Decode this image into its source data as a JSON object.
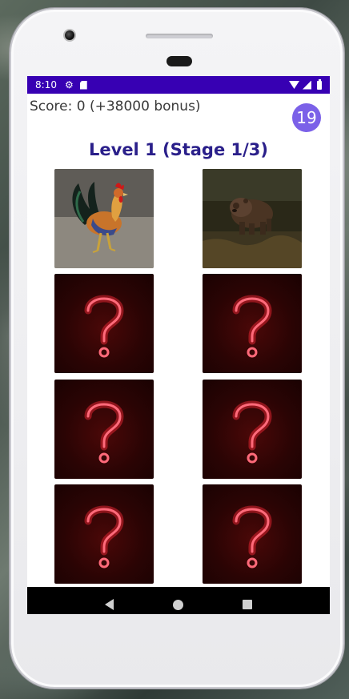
{
  "status_bar": {
    "time": "8:10",
    "background": "#3700b3"
  },
  "game": {
    "score_label": "Score: 0 (+38000 bonus)",
    "timer": "19",
    "level_title": "Level 1 (Stage 1/3)",
    "cards": [
      {
        "state": "revealed",
        "image": "rooster"
      },
      {
        "state": "revealed",
        "image": "bear"
      },
      {
        "state": "hidden",
        "image": "question-mark-icon"
      },
      {
        "state": "hidden",
        "image": "question-mark-icon"
      },
      {
        "state": "hidden",
        "image": "question-mark-icon"
      },
      {
        "state": "hidden",
        "image": "question-mark-icon"
      },
      {
        "state": "hidden",
        "image": "question-mark-icon"
      },
      {
        "state": "hidden",
        "image": "question-mark-icon"
      }
    ]
  },
  "colors": {
    "accent": "#7b61e8",
    "title": "#2a1f8a",
    "neon": "#ff2a3a"
  }
}
